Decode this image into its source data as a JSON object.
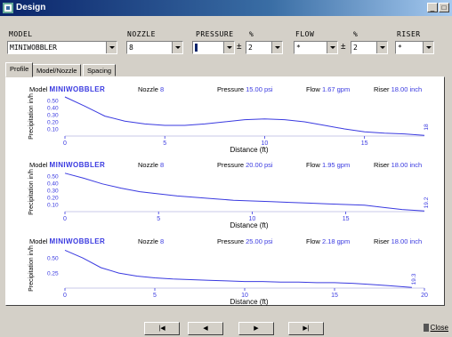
{
  "window": {
    "title": "Design",
    "min_label": "_",
    "max_label": "□"
  },
  "header": {
    "labels": {
      "model": "MODEL",
      "nozzle": "NOZZLE",
      "pressure": "PRESSURE",
      "pressure_pct": "%",
      "flow": "FLOW",
      "flow_pct": "%",
      "riser": "RISER"
    },
    "model_value": "MINIWOBBLER",
    "nozzle_value": "8",
    "pressure_value": "",
    "pressure_pct_value": "2",
    "flow_value": "*",
    "flow_pct_value": "2",
    "riser_value": "*",
    "plus_minus": "±"
  },
  "tabs": [
    {
      "label": "Profile",
      "active": true
    },
    {
      "label": "Model/Nozzle",
      "active": false
    },
    {
      "label": "Spacing",
      "active": false
    }
  ],
  "panels": [
    {
      "model_label": "Model",
      "model_value": "MINIWOBBLER",
      "nozzle_label": "Nozzle",
      "nozzle_value": "8",
      "pressure_label": "Pressure",
      "pressure_value": "15.00 psi",
      "flow_label": "Flow",
      "flow_value": "1.67 gpm",
      "riser_label": "Riser",
      "riser_value": "18.00 inch"
    },
    {
      "model_label": "Model",
      "model_value": "MINIWOBBLER",
      "nozzle_label": "Nozzle",
      "nozzle_value": "8",
      "pressure_label": "Pressure",
      "pressure_value": "20.00 psi",
      "flow_label": "Flow",
      "flow_value": "1.95 gpm",
      "riser_label": "Riser",
      "riser_value": "18.00 inch"
    },
    {
      "model_label": "Model",
      "model_value": "MINIWOBBLER",
      "nozzle_label": "Nozzle",
      "nozzle_value": "8",
      "pressure_label": "Pressure",
      "pressure_value": "25.00 psi",
      "flow_label": "Flow",
      "flow_value": "2.18 gpm",
      "riser_label": "Riser",
      "riser_value": "18.00 inch"
    }
  ],
  "chart_data": [
    {
      "type": "line",
      "xlabel": "Distance (ft)",
      "ylabel": "Precipitation in/h",
      "xlim": [
        0,
        18
      ],
      "ylim": [
        0,
        0.55
      ],
      "x_ticks": [
        0,
        5,
        10,
        15
      ],
      "y_ticks": [
        0.1,
        0.2,
        0.3,
        0.4,
        0.5
      ],
      "y_tick_labels": [
        "0.10",
        "0.20",
        "0.30",
        "0.40",
        "0.50"
      ],
      "end_label": "18",
      "series": [
        {
          "x": [
            0,
            1,
            2,
            3,
            4,
            5,
            6,
            7,
            8,
            9,
            10,
            11,
            12,
            13,
            14,
            15,
            16,
            17,
            18
          ],
          "y": [
            0.55,
            0.42,
            0.28,
            0.21,
            0.17,
            0.15,
            0.15,
            0.17,
            0.2,
            0.23,
            0.24,
            0.23,
            0.2,
            0.15,
            0.1,
            0.06,
            0.04,
            0.03,
            0.01
          ]
        }
      ]
    },
    {
      "type": "line",
      "xlabel": "Distance (ft)",
      "ylabel": "Precipitation in/h",
      "xlim": [
        0,
        19.2
      ],
      "ylim": [
        0,
        0.55
      ],
      "x_ticks": [
        0,
        5,
        10,
        15
      ],
      "y_ticks": [
        0.1,
        0.2,
        0.3,
        0.4,
        0.5
      ],
      "y_tick_labels": [
        "0.10",
        "0.20",
        "0.30",
        "0.40",
        "0.50"
      ],
      "end_label": "19.2",
      "series": [
        {
          "x": [
            0,
            1,
            2,
            3,
            4,
            5,
            6,
            7,
            8,
            9,
            10,
            11,
            12,
            13,
            14,
            15,
            16,
            17,
            18,
            19.2
          ],
          "y": [
            0.54,
            0.47,
            0.39,
            0.33,
            0.28,
            0.25,
            0.22,
            0.2,
            0.18,
            0.16,
            0.15,
            0.14,
            0.13,
            0.12,
            0.11,
            0.1,
            0.09,
            0.06,
            0.03,
            0.01
          ]
        }
      ]
    },
    {
      "type": "line",
      "xlabel": "Distance (ft)",
      "ylabel": "Precipitation in/h",
      "xlim": [
        0,
        20
      ],
      "ylim": [
        0,
        0.65
      ],
      "x_ticks": [
        0,
        5,
        10,
        15,
        20
      ],
      "y_ticks": [
        0.25,
        0.5
      ],
      "y_tick_labels": [
        "0.25",
        "0.50"
      ],
      "end_label": "19.3",
      "series": [
        {
          "x": [
            0,
            1,
            2,
            3,
            4,
            5,
            6,
            7,
            8,
            9,
            10,
            11,
            12,
            13,
            14,
            15,
            16,
            17,
            18,
            19.3
          ],
          "y": [
            0.63,
            0.5,
            0.34,
            0.25,
            0.2,
            0.17,
            0.15,
            0.14,
            0.13,
            0.12,
            0.11,
            0.11,
            0.1,
            0.1,
            0.09,
            0.09,
            0.08,
            0.06,
            0.04,
            0.01
          ]
        }
      ]
    }
  ],
  "nav": {
    "first": "|◀",
    "prev": "◀",
    "next": "▶",
    "last": "▶|",
    "close_label": "Close"
  },
  "colors": {
    "line": "#3a3ae0",
    "value_text": "#3a3ae0",
    "titlebar": "#0a246a"
  }
}
